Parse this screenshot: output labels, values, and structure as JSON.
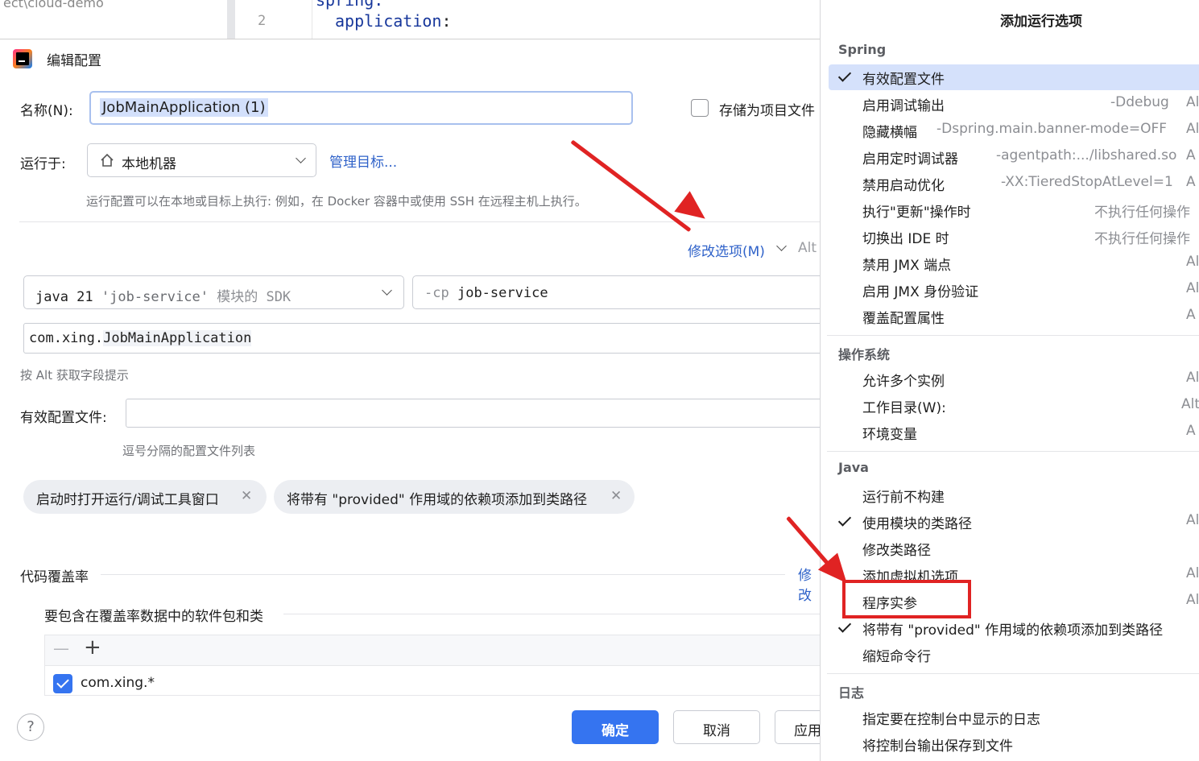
{
  "background": {
    "project_label": "ect\\cloud-demo",
    "line_number": "2",
    "code_top": "spring:",
    "code_line": "application",
    "code_colon": ":"
  },
  "dialog": {
    "title": "编辑配置",
    "name_label": "名称(N):",
    "name_value": "JobMainApplication (1)",
    "store_label": "存储为项目文件",
    "run_on_label": "运行于:",
    "run_on_value": "本地机器",
    "manage_targets": "管理目标...",
    "run_on_hint": "运行配置可以在本地或目标上执行: 例如，在 Docker 容器中或使用 SSH 在远程主机上执行。",
    "modify_options": "修改选项(M)",
    "modify_shortcut": "Alt",
    "sdk_java": "java 21",
    "sdk_module": "'job-service'",
    "sdk_suffix": "模块的 SDK",
    "cp_flag": "-cp",
    "cp_value": "job-service",
    "main_class_pkg": "com.xing.",
    "main_class_name": "JobMainApplication",
    "alt_hint": "按 Alt 获取字段提示",
    "profiles_label": "有效配置文件:",
    "profiles_hint": "逗号分隔的配置文件列表",
    "chips": [
      {
        "label": "启动时打开运行/调试工具窗口"
      },
      {
        "label": "将带有 \"provided\" 作用域的依赖项添加到类路径"
      }
    ],
    "coverage_title": "代码覆盖率",
    "coverage_modify": "修改",
    "coverage_sub": "要包含在覆盖率数据中的软件包和类",
    "minus": "—",
    "plus": "+",
    "coverage_item": "com.xing.*",
    "ok": "确定",
    "cancel": "取消",
    "apply": "应用",
    "help": "?"
  },
  "popup": {
    "title": "添加运行选项",
    "groups": [
      {
        "name": "Spring",
        "items": [
          {
            "label": "有效配置文件",
            "checked": true,
            "selected": true,
            "hint": "",
            "shortcut": ""
          },
          {
            "label": "启用调试输出",
            "checked": false,
            "hint": "-Ddebug",
            "shortcut": "Al"
          },
          {
            "label": "隐藏横幅",
            "checked": false,
            "hint": "-Dspring.main.banner-mode=OFF",
            "shortcut": "Al"
          },
          {
            "label": "启用定时调试器",
            "checked": false,
            "hint": "-agentpath:.../libshared.so",
            "shortcut": "A"
          },
          {
            "label": "禁用启动优化",
            "checked": false,
            "hint": "-XX:TieredStopAtLevel=1",
            "shortcut": "A"
          },
          {
            "label": "执行\"更新\"操作时",
            "checked": false,
            "hint": "不执行任何操作",
            "shortcut": ""
          },
          {
            "label": "切换出 IDE 时",
            "checked": false,
            "hint": "不执行任何操作",
            "shortcut": ""
          },
          {
            "label": "禁用 JMX 端点",
            "checked": false,
            "hint": "",
            "shortcut": "Al"
          },
          {
            "label": "启用 JMX 身份验证",
            "checked": false,
            "hint": "",
            "shortcut": "Al"
          },
          {
            "label": "覆盖配置属性",
            "checked": false,
            "hint": "",
            "shortcut": "A"
          }
        ]
      },
      {
        "name": "操作系统",
        "items": [
          {
            "label": "允许多个实例",
            "checked": false,
            "hint": "",
            "shortcut": "Al"
          },
          {
            "label": "工作目录(W):",
            "checked": false,
            "hint": "",
            "shortcut": "Alt"
          },
          {
            "label": "环境变量",
            "checked": false,
            "hint": "",
            "shortcut": "A"
          }
        ]
      },
      {
        "name": "Java",
        "items": [
          {
            "label": "运行前不构建",
            "checked": false,
            "hint": "",
            "shortcut": ""
          },
          {
            "label": "使用模块的类路径",
            "checked": true,
            "hint": "",
            "shortcut": "Al"
          },
          {
            "label": "修改类路径",
            "checked": false,
            "hint": "",
            "shortcut": ""
          },
          {
            "label": "添加虚拟机选项",
            "checked": false,
            "hint": "",
            "shortcut": "Al"
          },
          {
            "label": "程序实参",
            "checked": false,
            "hint": "",
            "shortcut": "Al"
          },
          {
            "label": "将带有 \"provided\" 作用域的依赖项添加到类路径",
            "checked": true,
            "hint": "",
            "shortcut": ""
          },
          {
            "label": "缩短命令行",
            "checked": false,
            "hint": "",
            "shortcut": ""
          }
        ]
      },
      {
        "name": "日志",
        "items": [
          {
            "label": "指定要在控制台中显示的日志",
            "checked": false,
            "hint": "",
            "shortcut": ""
          },
          {
            "label": "将控制台输出保存到文件",
            "checked": false,
            "hint": "",
            "shortcut": ""
          }
        ]
      }
    ]
  }
}
